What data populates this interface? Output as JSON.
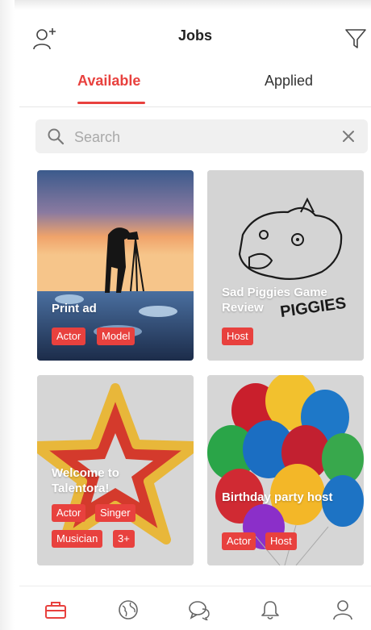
{
  "header": {
    "title": "Jobs",
    "add_user_icon": "add-user-icon",
    "filter_icon": "filter-icon"
  },
  "tabs": [
    {
      "label": "Available",
      "active": true
    },
    {
      "label": "Applied",
      "active": false
    }
  ],
  "search": {
    "placeholder": "Search"
  },
  "cards": [
    {
      "title": "Print ad",
      "tags": [
        "Actor",
        "Model"
      ]
    },
    {
      "title": "Sad Piggies Game Review",
      "tags": [
        "Host"
      ]
    },
    {
      "title": "Welcome to Talentora!",
      "tags": [
        "Actor",
        "Singer",
        "Musician",
        "3+"
      ]
    },
    {
      "title": "Birthday party host",
      "tags": [
        "Actor",
        "Host"
      ]
    }
  ],
  "bottom_nav": [
    {
      "icon": "briefcase-icon",
      "active": true
    },
    {
      "icon": "globe-icon",
      "active": false
    },
    {
      "icon": "chat-icon",
      "active": false
    },
    {
      "icon": "bell-icon",
      "active": false
    },
    {
      "icon": "profile-icon",
      "active": false
    }
  ],
  "colors": {
    "accent": "#e8413e",
    "card_bg": "#d6d6d6"
  }
}
